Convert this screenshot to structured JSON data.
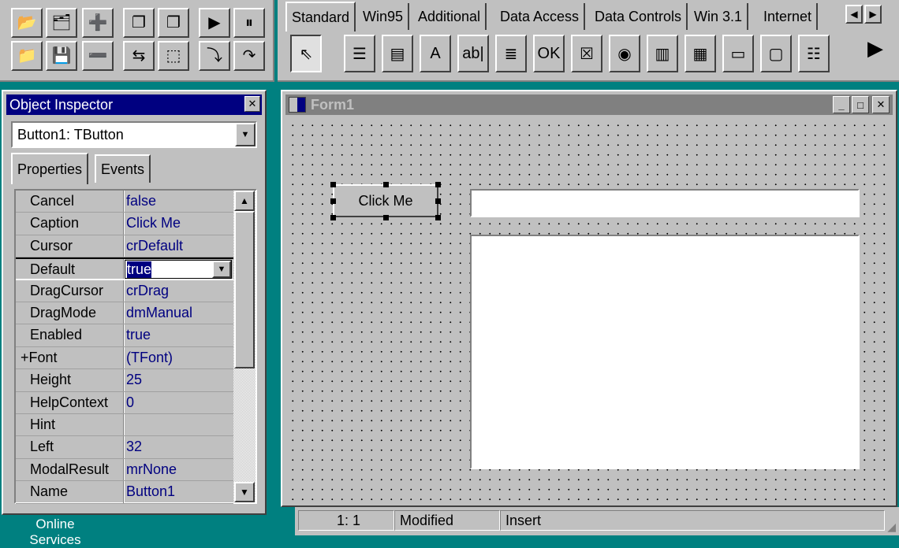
{
  "speedbar": {
    "buttons": [
      {
        "name": "open-project-icon",
        "glyph": "📂"
      },
      {
        "name": "save-all-icon",
        "glyph": "🗂"
      },
      {
        "name": "add-file-icon",
        "glyph": "➕"
      },
      {
        "name": "select-unit-icon",
        "glyph": "❐"
      },
      {
        "name": "select-form-icon",
        "glyph": "❐"
      },
      {
        "name": "run-icon",
        "glyph": "▶"
      },
      {
        "name": "pause-icon",
        "glyph": "⏸"
      },
      {
        "name": "open-icon",
        "glyph": "📁"
      },
      {
        "name": "save-icon",
        "glyph": "💾"
      },
      {
        "name": "remove-file-icon",
        "glyph": "➖"
      },
      {
        "name": "toggle-form-unit-icon",
        "glyph": "⇆"
      },
      {
        "name": "new-form-icon",
        "glyph": "⬚"
      },
      {
        "name": "trace-into-icon",
        "glyph": "⤵"
      },
      {
        "name": "step-over-icon",
        "glyph": "↷"
      }
    ]
  },
  "palette": {
    "tabs": [
      "Standard",
      "Win95",
      "Additional",
      "Data Access",
      "Data Controls",
      "Win 3.1",
      "Internet"
    ],
    "active_tab": "Standard",
    "components": [
      {
        "name": "pointer-icon",
        "glyph": "⇖"
      },
      {
        "name": "mainmenu-icon",
        "glyph": "☰"
      },
      {
        "name": "popupmenu-icon",
        "glyph": "▤"
      },
      {
        "name": "label-icon",
        "glyph": "A"
      },
      {
        "name": "edit-icon",
        "glyph": "ab|"
      },
      {
        "name": "memo-icon",
        "glyph": "≣"
      },
      {
        "name": "button-icon",
        "glyph": "OK"
      },
      {
        "name": "checkbox-icon",
        "glyph": "☒"
      },
      {
        "name": "radiobutton-icon",
        "glyph": "◉"
      },
      {
        "name": "listbox-icon",
        "glyph": "▥"
      },
      {
        "name": "combobox-icon",
        "glyph": "▦"
      },
      {
        "name": "scrollbar-icon",
        "glyph": "▭"
      },
      {
        "name": "groupbox-icon",
        "glyph": "▢"
      },
      {
        "name": "radiogroup-icon",
        "glyph": "☷"
      }
    ]
  },
  "inspector": {
    "title": "Object Inspector",
    "selected_object": "Button1: TButton",
    "tabs": [
      "Properties",
      "Events"
    ],
    "properties": [
      {
        "name": "Cancel",
        "value": "false"
      },
      {
        "name": "Caption",
        "value": "Click Me"
      },
      {
        "name": "Cursor",
        "value": "crDefault"
      },
      {
        "name": "Default",
        "value": "true"
      },
      {
        "name": "DragCursor",
        "value": "crDrag"
      },
      {
        "name": "DragMode",
        "value": "dmManual"
      },
      {
        "name": "Enabled",
        "value": "true"
      },
      {
        "name": "+Font",
        "value": "(TFont)"
      },
      {
        "name": "Height",
        "value": "25"
      },
      {
        "name": "HelpContext",
        "value": "0"
      },
      {
        "name": "Hint",
        "value": ""
      },
      {
        "name": "Left",
        "value": "32"
      },
      {
        "name": "ModalResult",
        "value": "mrNone"
      },
      {
        "name": "Name",
        "value": "Button1"
      }
    ],
    "editing_property_index": 3
  },
  "form": {
    "title": "Form1",
    "button_caption": "Click Me"
  },
  "editor_status": {
    "position": "1:   1",
    "modified": "Modified",
    "mode": "Insert"
  },
  "desktop": {
    "icon_label_line1": "Online",
    "icon_label_line2": "Services"
  },
  "colors": {
    "desktop": "#008080",
    "active_title": "#000080",
    "inactive_title": "#808080",
    "face": "#c0c0c0"
  }
}
